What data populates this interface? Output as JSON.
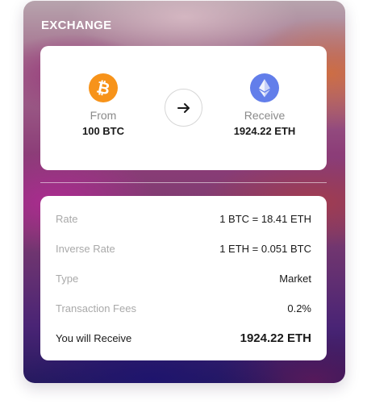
{
  "header": {
    "title": "EXCHANGE"
  },
  "swap": {
    "from": {
      "label": "From",
      "amount": "100 BTC",
      "icon": "bitcoin-icon",
      "color": "#f7931a"
    },
    "to": {
      "label": "Receive",
      "amount": "1924.22 ETH",
      "icon": "ethereum-icon",
      "color": "#627eea"
    },
    "action_icon": "arrow-right-icon"
  },
  "details": {
    "rows": [
      {
        "label": "Rate",
        "value": "1 BTC = 18.41 ETH"
      },
      {
        "label": "Inverse Rate",
        "value": "1 ETH = 0.051 BTC"
      },
      {
        "label": "Type",
        "value": "Market"
      },
      {
        "label": "Transaction Fees",
        "value": "0.2%"
      }
    ],
    "total": {
      "label": "You will Receive",
      "value": "1924.22 ETH"
    }
  }
}
